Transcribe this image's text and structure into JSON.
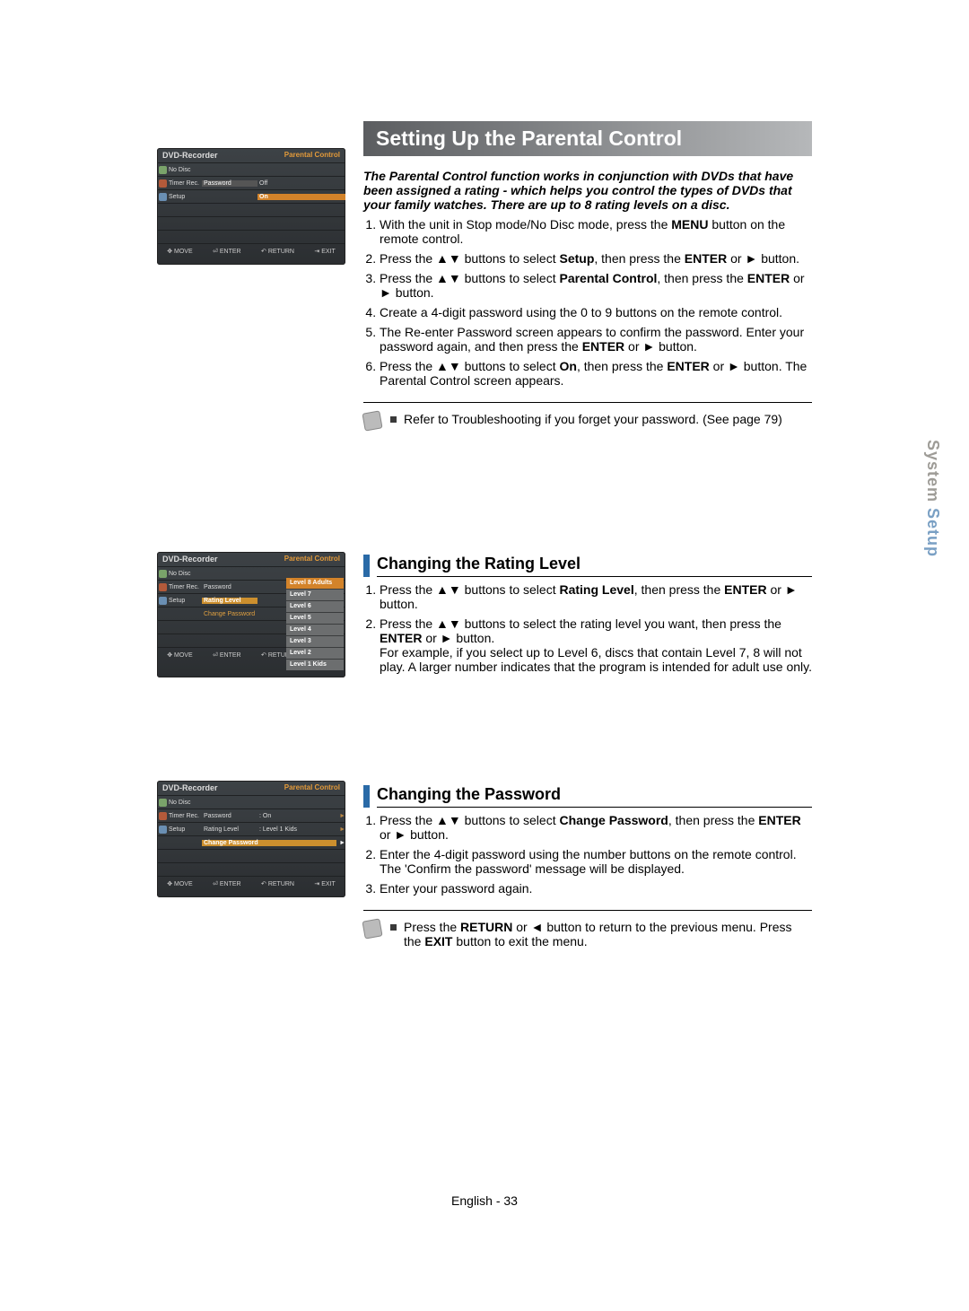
{
  "sideTab": {
    "inactive": "System ",
    "active": "Setup"
  },
  "footer": "English - 33",
  "titleBar": "Setting Up the Parental Control",
  "intro": "The Parental Control function works in conjunction with DVDs that have been assigned a rating - which helps you control the types of DVDs that your family watches. There are up to 8 rating levels on a disc.",
  "steps1": {
    "s1a": "With the unit in Stop mode/No Disc mode, press the ",
    "s1b": "MENU",
    "s1c": " button on the remote control.",
    "s2a": "Press the  ▲▼ buttons to select ",
    "s2b": "Setup",
    "s2c": ", then press the ",
    "s2d": "ENTER",
    "s2e": " or ► button.",
    "s3a": "Press the  ▲▼ buttons to select ",
    "s3b": "Parental Control",
    "s3c": ", then press the ",
    "s3d": "ENTER",
    "s3e": " or ► button.",
    "s4": "Create a 4-digit password using the 0 to 9 buttons on the remote control.",
    "s5a": "The Re-enter Password screen appears to confirm the password. Enter your password again, and then press the ",
    "s5b": "ENTER",
    "s5c": " or ► button.",
    "s6a": "Press the  ▲▼ buttons to select ",
    "s6b": "On",
    "s6c": ", then press the ",
    "s6d": "ENTER",
    "s6e": " or ► button. The Parental Control screen appears."
  },
  "note1": "Refer to Troubleshooting if you forget your password. (See page 79)",
  "subhead2": "Changing the Rating Level",
  "steps2": {
    "s1a": "Press the  ▲▼ buttons to select ",
    "s1b": "Rating Level",
    "s1c": ", then press the ",
    "s1d": "ENTER",
    "s1e": " or ► button.",
    "s2a": "Press the  ▲▼ buttons to select the rating level you want, then press the ",
    "s2b": "ENTER",
    "s2c": " or ► button.",
    "s2d": "For example, if you select up to Level 6, discs that contain Level 7, 8 will not play. A larger number indicates that the program is intended for adult use only."
  },
  "subhead3": "Changing the Password",
  "steps3": {
    "s1a": "Press the  ▲▼ buttons to select ",
    "s1b": "Change Password",
    "s1c": ", then press the ",
    "s1d": "ENTER",
    "s1e": " or ► button.",
    "s2a": "Enter the 4-digit password using the number buttons on the remote control.",
    "s2b": "The 'Confirm the password' message will be displayed.",
    "s3": "Enter your password again."
  },
  "note2a": "Press the ",
  "note2b": "RETURN",
  "note2c": " or ◄ button to return to the previous menu. Press the ",
  "note2d": "EXIT",
  "note2e": " button to exit the menu.",
  "osd": {
    "title": "DVD-Recorder",
    "pc": "Parental Control",
    "nodisc": "No Disc",
    "timer": "Timer Rec.",
    "setup": "Setup",
    "password": "Password",
    "off": "Off",
    "on": "On",
    "ratinglevel": "Rating Level",
    "changepw": "Change Password",
    "l1kids": ": Level 1 Kids",
    "onval": ": On",
    "levels": [
      "Level  8 Adults",
      "Level  7",
      "Level  6",
      "Level  5",
      "Level  4",
      "Level  3",
      "Level  2",
      "Level  1 Kids"
    ],
    "footer": {
      "move": "MOVE",
      "enter": "ENTER",
      "return": "RETURN",
      "exit": "EXIT"
    }
  }
}
